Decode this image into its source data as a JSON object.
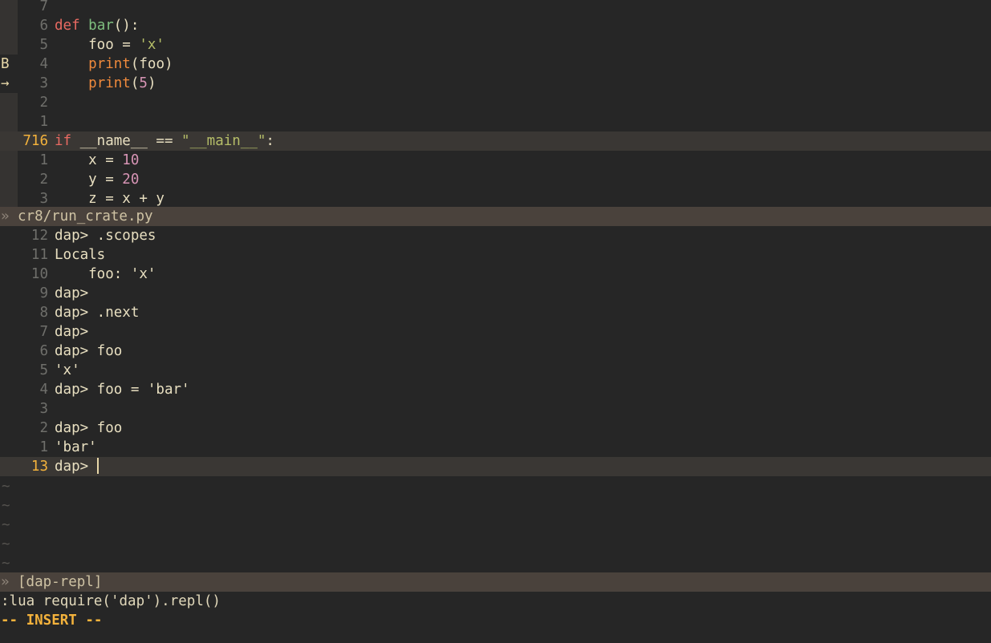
{
  "app": {
    "name": "neovim",
    "colors": {
      "background": "#262626",
      "statusline_bg": "#4a423c",
      "cursorline_bg": "#3a3734",
      "signcolumn_bg": "#353331",
      "linenr": "#6f6f6b",
      "cursor_linenr": "#f3b23c",
      "keyword": "#e96a62",
      "function": "#7fbf7f",
      "string": "#b5bd68",
      "builtin": "#f08a3c",
      "number": "#d794b5",
      "normal_text": "#e8dfc0",
      "mode_insert": "#f3b23c"
    }
  },
  "editor": {
    "signs": {
      "breakpoint": "B",
      "current_frame": "→"
    },
    "lines": [
      {
        "sign": "",
        "num": "7",
        "cursorline": false,
        "tokens": []
      },
      {
        "sign": "",
        "num": "6",
        "cursorline": false,
        "tokens": [
          {
            "t": "def ",
            "c": "kw"
          },
          {
            "t": "bar",
            "c": "fn"
          },
          {
            "t": "():",
            "c": "plain"
          }
        ]
      },
      {
        "sign": "",
        "num": "5",
        "cursorline": false,
        "tokens": [
          {
            "t": "    foo = ",
            "c": "plain"
          },
          {
            "t": "'x'",
            "c": "str"
          }
        ]
      },
      {
        "sign": "B",
        "num": "4",
        "cursorline": false,
        "tokens": [
          {
            "t": "    ",
            "c": "plain"
          },
          {
            "t": "print",
            "c": "builtin"
          },
          {
            "t": "(foo)",
            "c": "plain"
          }
        ]
      },
      {
        "sign": "→",
        "num": "3",
        "cursorline": false,
        "tokens": [
          {
            "t": "    ",
            "c": "plain"
          },
          {
            "t": "print",
            "c": "builtin"
          },
          {
            "t": "(",
            "c": "plain"
          },
          {
            "t": "5",
            "c": "numlit"
          },
          {
            "t": ")",
            "c": "plain"
          }
        ]
      },
      {
        "sign": "",
        "num": "2",
        "cursorline": false,
        "tokens": []
      },
      {
        "sign": "",
        "num": "1",
        "cursorline": false,
        "tokens": []
      },
      {
        "sign": "",
        "num": "716",
        "cursorline": true,
        "tokens": [
          {
            "t": "if ",
            "c": "kw"
          },
          {
            "t": "__name__ == ",
            "c": "plain"
          },
          {
            "t": "\"__main__\"",
            "c": "str"
          },
          {
            "t": ":",
            "c": "plain"
          }
        ]
      },
      {
        "sign": "",
        "num": "1",
        "cursorline": false,
        "tokens": [
          {
            "t": "    x = ",
            "c": "plain"
          },
          {
            "t": "10",
            "c": "numlit"
          }
        ]
      },
      {
        "sign": "",
        "num": "2",
        "cursorline": false,
        "tokens": [
          {
            "t": "    y = ",
            "c": "plain"
          },
          {
            "t": "20",
            "c": "numlit"
          }
        ]
      },
      {
        "sign": "",
        "num": "3",
        "cursorline": false,
        "tokens": [
          {
            "t": "    z = x + y",
            "c": "plain"
          }
        ]
      }
    ],
    "statusline": {
      "chevron": "»",
      "buffer_name": "cr8/run_crate.py"
    }
  },
  "repl": {
    "lines": [
      {
        "num": "12",
        "text": "dap> .scopes",
        "cursorline": false
      },
      {
        "num": "11",
        "text": "Locals",
        "cursorline": false
      },
      {
        "num": "10",
        "text": "    foo: 'x'",
        "cursorline": false
      },
      {
        "num": "9",
        "text": "dap>",
        "cursorline": false
      },
      {
        "num": "8",
        "text": "dap> .next",
        "cursorline": false
      },
      {
        "num": "7",
        "text": "dap>",
        "cursorline": false
      },
      {
        "num": "6",
        "text": "dap> foo",
        "cursorline": false
      },
      {
        "num": "5",
        "text": "'x'",
        "cursorline": false
      },
      {
        "num": "4",
        "text": "dap> foo = 'bar'",
        "cursorline": false
      },
      {
        "num": "3",
        "text": "",
        "cursorline": false
      },
      {
        "num": "2",
        "text": "dap> foo",
        "cursorline": false
      },
      {
        "num": "1",
        "text": "'bar'",
        "cursorline": false
      },
      {
        "num": "13",
        "text": "dap> ",
        "cursorline": true
      }
    ],
    "tildes": [
      "~",
      "~",
      "~",
      "~",
      "~"
    ],
    "statusline": {
      "chevron": "»",
      "buffer_name": "[dap-repl]"
    }
  },
  "command": {
    "line": ":lua require('dap').repl()",
    "mode": "-- INSERT --"
  }
}
